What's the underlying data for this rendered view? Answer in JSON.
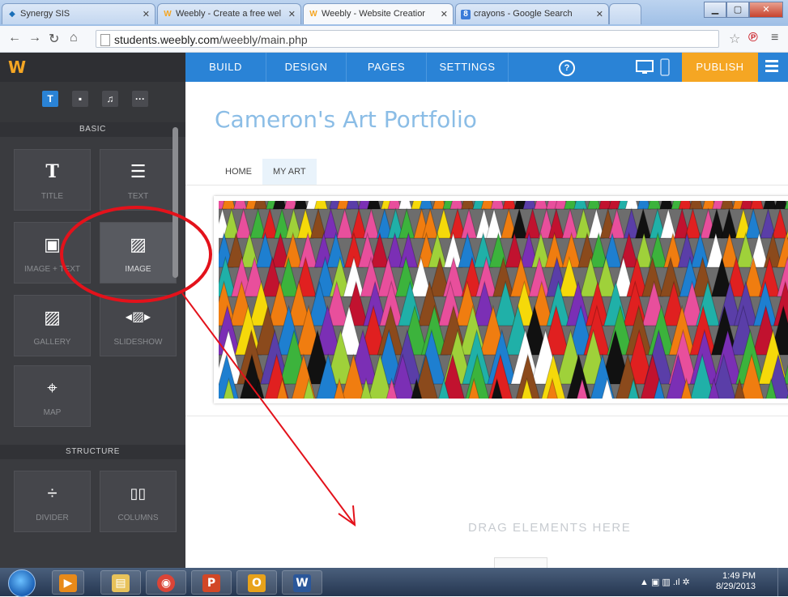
{
  "browser": {
    "tabs": [
      {
        "title": "Synergy SIS",
        "favicon": "synergy-icon",
        "color": "#1a6fb8"
      },
      {
        "title": "Weebly - Create a free wel",
        "favicon": "weebly-icon",
        "color": "#f5a623"
      },
      {
        "title": "Weebly - Website Creatior",
        "favicon": "weebly-icon",
        "color": "#f5a623",
        "active": true
      },
      {
        "title": "crayons - Google Search",
        "favicon": "google-icon",
        "color": "#3b7bd8"
      }
    ],
    "url_domain": "students.weebly.com",
    "url_path": "/weebly/main.php"
  },
  "weebly": {
    "logo": "W",
    "nav": [
      "BUILD",
      "DESIGN",
      "PAGES",
      "SETTINGS"
    ],
    "help": "?",
    "publish": "PUBLISH",
    "accent": "#2a83d6",
    "publish_color": "#f5a623"
  },
  "sidebar": {
    "tabs": [
      {
        "glyph": "T",
        "icon": "text-tab-icon",
        "active": true
      },
      {
        "glyph": "▪",
        "icon": "layout-tab-icon"
      },
      {
        "glyph": "♫",
        "icon": "music-tab-icon"
      },
      {
        "glyph": "···",
        "icon": "more-tab-icon"
      }
    ],
    "sections": {
      "basic": "BASIC",
      "structure": "STRUCTURE"
    },
    "elements": [
      {
        "label": "TITLE",
        "glyph": "T",
        "icon": "title-icon"
      },
      {
        "label": "TEXT",
        "glyph": "☰",
        "icon": "text-icon"
      },
      {
        "label": "IMAGE + TEXT",
        "glyph": "▣",
        "icon": "image-text-icon"
      },
      {
        "label": "IMAGE",
        "glyph": "▨",
        "icon": "image-icon",
        "highlighted": true
      },
      {
        "label": "GALLERY",
        "glyph": "▨",
        "icon": "gallery-icon"
      },
      {
        "label": "SLIDESHOW",
        "glyph": "◂▨▸",
        "icon": "slideshow-icon"
      },
      {
        "label": "MAP",
        "glyph": "⌖",
        "icon": "map-icon"
      },
      {
        "label": "DIVIDER",
        "glyph": "÷",
        "icon": "divider-icon"
      },
      {
        "label": "COLUMNS",
        "glyph": "▯▯",
        "icon": "columns-icon"
      }
    ]
  },
  "site": {
    "title": "Cameron's Art Portfolio",
    "nav": [
      "HOME",
      "MY ART"
    ],
    "current_nav": "MY ART",
    "drop_hint": "DRAG ELEMENTS HERE",
    "banner_alt": "crayons-image"
  },
  "taskbar": {
    "time": "1:49 PM",
    "date": "8/29/2013",
    "apps": [
      {
        "glyph": "▶",
        "icon": "media-player-icon",
        "color": "#e88a1a"
      },
      {
        "glyph": "▤",
        "icon": "file-explorer-icon",
        "color": "#e8c25a"
      },
      {
        "glyph": "◉",
        "icon": "chrome-icon",
        "color": "#db4437"
      },
      {
        "glyph": "P",
        "icon": "powerpoint-icon",
        "color": "#d24726"
      },
      {
        "glyph": "O",
        "icon": "outlook-icon",
        "color": "#e8a21a"
      },
      {
        "glyph": "W",
        "icon": "word-icon",
        "color": "#2b579a"
      }
    ]
  }
}
